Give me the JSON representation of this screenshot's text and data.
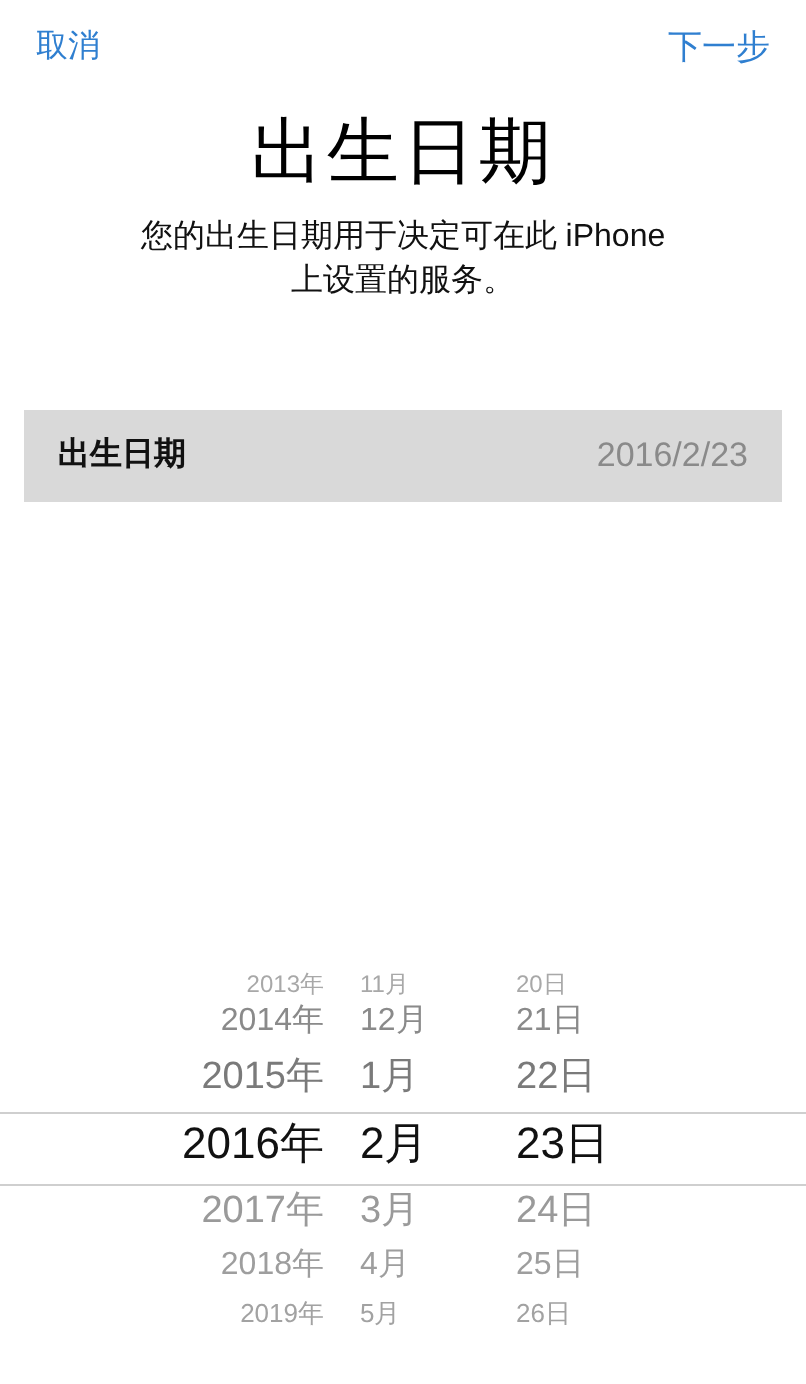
{
  "nav": {
    "cancel": "取消",
    "next": "下一步"
  },
  "title": "出生日期",
  "description": "您的出生日期用于决定可在此 iPhone 上设置的服务。",
  "field": {
    "label": "出生日期",
    "value": "2016/2/23"
  },
  "picker": {
    "columns": [
      {
        "items": [
          {
            "label": "2013年",
            "selected": false
          },
          {
            "label": "2014年",
            "selected": false
          },
          {
            "label": "2015年",
            "selected": false
          },
          {
            "label": "2016年",
            "selected": true
          },
          {
            "label": "2017年",
            "selected": false
          },
          {
            "label": "2018年",
            "selected": false
          },
          {
            "label": "2019年",
            "selected": false
          }
        ]
      },
      {
        "items": [
          {
            "label": "11月",
            "selected": false
          },
          {
            "label": "12月",
            "selected": false
          },
          {
            "label": "1月",
            "selected": false
          },
          {
            "label": "2月",
            "selected": true
          },
          {
            "label": "3月",
            "selected": false
          },
          {
            "label": "4月",
            "selected": false
          },
          {
            "label": "5月",
            "selected": false
          }
        ]
      },
      {
        "items": [
          {
            "label": "20日",
            "selected": false
          },
          {
            "label": "21日",
            "selected": false
          },
          {
            "label": "22日",
            "selected": false
          },
          {
            "label": "23日",
            "selected": true
          },
          {
            "label": "24日",
            "selected": false
          },
          {
            "label": "25日",
            "selected": false
          },
          {
            "label": "26日",
            "selected": false
          }
        ]
      }
    ]
  }
}
